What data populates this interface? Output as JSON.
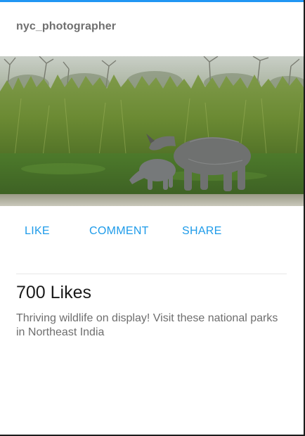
{
  "post": {
    "username": "nyc_photographer",
    "image_alt": "Rhinoceros and calf grazing in tall grassland",
    "actions": {
      "like": "LIKE",
      "comment": "COMMENT",
      "share": "SHARE"
    },
    "likes_text": "700 Likes",
    "caption": "Thriving wildlife on display! Visit these national parks in Northeast India"
  },
  "colors": {
    "accent": "#1e9be9",
    "top_bar": "#2196f3",
    "username": "#6f6f6f",
    "caption": "#6e6e6e"
  }
}
